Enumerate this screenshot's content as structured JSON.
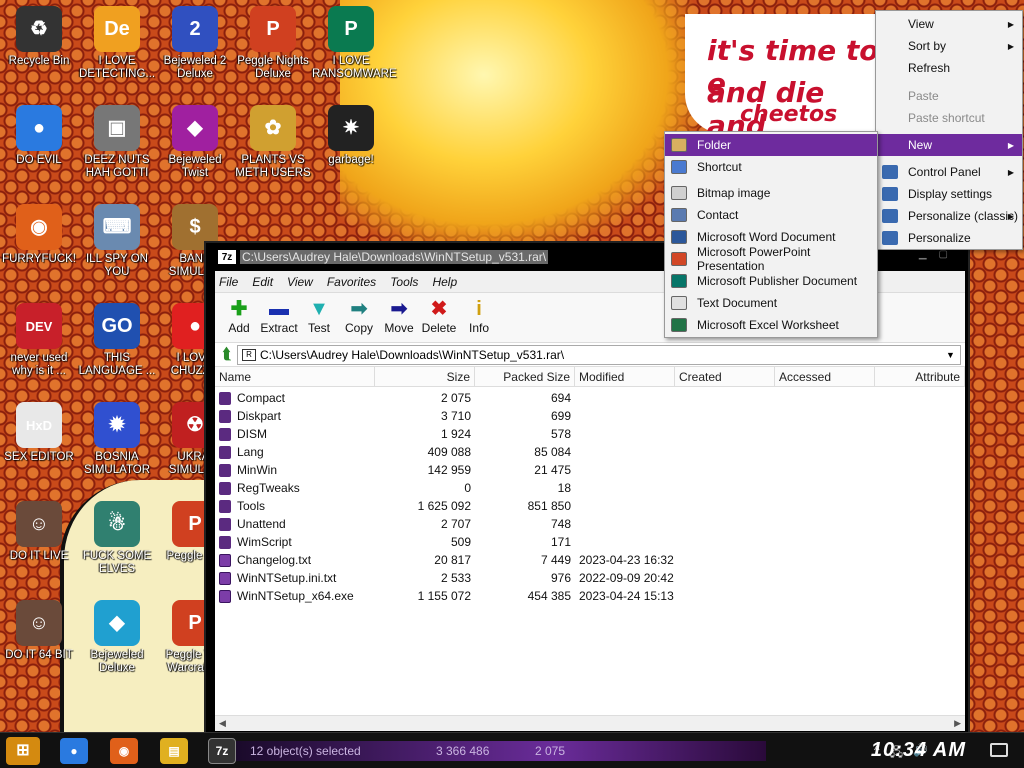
{
  "banner": {
    "line1": "it's time to e",
    "line2": "and die and",
    "line3": "cheetos anc"
  },
  "desktop_icons": [
    {
      "label": "Recycle Bin",
      "icon": "recycle-bin-icon",
      "color": "#333333",
      "glyph": "♻"
    },
    {
      "label": "I LOVE DETECTING...",
      "icon": "detect-it-easy-icon",
      "color": "#f0a020",
      "glyph": "De"
    },
    {
      "label": "Bejeweled 2 Deluxe",
      "icon": "bejeweled2-icon",
      "color": "#3050c0",
      "glyph": "2"
    },
    {
      "label": "Peggle Nights Deluxe",
      "icon": "peggle-nights-icon",
      "color": "#d04020",
      "glyph": "P"
    },
    {
      "label": "I LOVE RANSOMWARE",
      "icon": "publisher-icon",
      "color": "#0a7a50",
      "glyph": "P"
    },
    {
      "label": "DO EVIL",
      "icon": "chrome-icon",
      "color": "#2a7ae0",
      "glyph": "●"
    },
    {
      "label": "DEEZ NUTS HAH GOTTI",
      "icon": "windows-stack-icon",
      "color": "#777777",
      "glyph": "▣"
    },
    {
      "label": "Bejeweled Twist",
      "icon": "bejeweled-twist-icon",
      "color": "#a020a0",
      "glyph": "◆"
    },
    {
      "label": "PLANTS VS METH USERS",
      "icon": "plants-vs-zombies-icon",
      "color": "#d0a030",
      "glyph": "✿"
    },
    {
      "label": "garbage!",
      "icon": "garbage-icon",
      "color": "#222222",
      "glyph": "✷"
    },
    {
      "label": "FURRYFUCK!",
      "icon": "firefox-icon",
      "color": "#e0601a",
      "glyph": "◉"
    },
    {
      "label": "ILL SPY ON YOU",
      "icon": "network-pc-icon",
      "color": "#6a8ab0",
      "glyph": "⌨"
    },
    {
      "label": "BANK SIMULA...",
      "icon": "money-bag-icon",
      "color": "#a07030",
      "glyph": "$"
    },
    {
      "label": "never used why is it ...",
      "icon": "dev-cpp-icon",
      "color": "#c8202a",
      "glyph": "DEV"
    },
    {
      "label": "THIS LANGUAGE ...",
      "icon": "goland-icon",
      "color": "#2050b0",
      "glyph": "GO"
    },
    {
      "label": "I LOVE CHUZZ...",
      "icon": "chuzzle-icon",
      "color": "#e02020",
      "glyph": "●"
    },
    {
      "label": "SEX EDITOR",
      "icon": "hxd-icon",
      "color": "#e8e8e8",
      "glyph": "HxD"
    },
    {
      "label": "BOSNIA SIMULATOR",
      "icon": "mine-icon",
      "color": "#3050d0",
      "glyph": "✹"
    },
    {
      "label": "UKRAI SIMULA...",
      "icon": "radiation-icon",
      "color": "#c02020",
      "glyph": "☢"
    },
    {
      "label": "DO IT LIVE",
      "icon": "portrait-icon",
      "color": "#6a4a3a",
      "glyph": "☺"
    },
    {
      "label": "FUCK SOME ELVES",
      "icon": "santa-icon",
      "color": "#308070",
      "glyph": "☃"
    },
    {
      "label": "Peggle D...",
      "icon": "peggle-icon",
      "color": "#d04020",
      "glyph": "P"
    },
    {
      "label": "DO IT 64 BIT",
      "icon": "portrait-64-icon",
      "color": "#6a4a3a",
      "glyph": "☺"
    },
    {
      "label": "Bejeweled Deluxe",
      "icon": "diamond-icon",
      "color": "#20a0d0",
      "glyph": "◆"
    },
    {
      "label": "Peggle W... Warcraft ...",
      "icon": "peggle-wow-icon",
      "color": "#d04020",
      "glyph": "P"
    }
  ],
  "window": {
    "title": "C:\\Users\\Audrey Hale\\Downloads\\WinNTSetup_v531.rar\\",
    "app_icon_text": "7z",
    "menu": [
      "File",
      "Edit",
      "View",
      "Favorites",
      "Tools",
      "Help"
    ],
    "toolbar": [
      {
        "label": "Add",
        "glyph": "✚",
        "color": "#1aa01a",
        "icon": "add-icon"
      },
      {
        "label": "Extract",
        "glyph": "▬",
        "color": "#1a30b0",
        "icon": "extract-icon"
      },
      {
        "label": "Test",
        "glyph": "▼",
        "color": "#20b0b0",
        "icon": "test-icon"
      },
      {
        "label": "Copy",
        "glyph": "➡",
        "color": "#208080",
        "icon": "copy-icon"
      },
      {
        "label": "Move",
        "glyph": "➡",
        "color": "#1a1a90",
        "icon": "move-icon"
      },
      {
        "label": "Delete",
        "glyph": "✖",
        "color": "#d01a1a",
        "icon": "delete-icon"
      },
      {
        "label": "Info",
        "glyph": "i",
        "color": "#d0a010",
        "icon": "info-icon"
      }
    ],
    "address": "C:\\Users\\Audrey Hale\\Downloads\\WinNTSetup_v531.rar\\",
    "columns": [
      "Name",
      "Size",
      "Packed Size",
      "Modified",
      "Created",
      "Accessed",
      "Attribute"
    ],
    "rows": [
      {
        "name": "Compact",
        "size": "2 075",
        "packed": "694",
        "modified": "",
        "type": "folder"
      },
      {
        "name": "Diskpart",
        "size": "3 710",
        "packed": "699",
        "modified": "",
        "type": "folder"
      },
      {
        "name": "DISM",
        "size": "1 924",
        "packed": "578",
        "modified": "",
        "type": "folder"
      },
      {
        "name": "Lang",
        "size": "409 088",
        "packed": "85 084",
        "modified": "",
        "type": "folder"
      },
      {
        "name": "MinWin",
        "size": "142 959",
        "packed": "21 475",
        "modified": "",
        "type": "folder"
      },
      {
        "name": "RegTweaks",
        "size": "0",
        "packed": "18",
        "modified": "",
        "type": "folder"
      },
      {
        "name": "Tools",
        "size": "1 625 092",
        "packed": "851 850",
        "modified": "",
        "type": "folder"
      },
      {
        "name": "Unattend",
        "size": "2 707",
        "packed": "748",
        "modified": "",
        "type": "folder"
      },
      {
        "name": "WimScript",
        "size": "509",
        "packed": "171",
        "modified": "",
        "type": "folder"
      },
      {
        "name": "Changelog.txt",
        "size": "20 817",
        "packed": "7 449",
        "modified": "2023-04-23 16:32",
        "type": "file"
      },
      {
        "name": "WinNTSetup.ini.txt",
        "size": "2 533",
        "packed": "976",
        "modified": "2022-09-09 20:42",
        "type": "file"
      },
      {
        "name": "WinNTSetup_x64.exe",
        "size": "1 155 072",
        "packed": "454 385",
        "modified": "2023-04-24 15:13",
        "type": "file"
      }
    ]
  },
  "context_menu": {
    "items": [
      {
        "label": "View",
        "has_submenu": true,
        "disabled": false,
        "icon": ""
      },
      {
        "label": "Sort by",
        "has_submenu": true,
        "disabled": false,
        "icon": ""
      },
      {
        "label": "Refresh",
        "has_submenu": false,
        "disabled": false,
        "icon": ""
      },
      {
        "label": "Paste",
        "has_submenu": false,
        "disabled": true,
        "icon": ""
      },
      {
        "label": "Paste shortcut",
        "has_submenu": false,
        "disabled": true,
        "icon": ""
      },
      {
        "label": "New",
        "has_submenu": true,
        "disabled": false,
        "selected": true,
        "icon": ""
      },
      {
        "label": "Control Panel",
        "has_submenu": true,
        "disabled": false,
        "icon": "control-panel-icon"
      },
      {
        "label": "Display settings",
        "has_submenu": false,
        "disabled": false,
        "icon": "display-icon"
      },
      {
        "label": "Personalize (classic)",
        "has_submenu": true,
        "disabled": false,
        "icon": "personalize-classic-icon"
      },
      {
        "label": "Personalize",
        "has_submenu": false,
        "disabled": false,
        "icon": "personalize-icon"
      }
    ]
  },
  "new_submenu": {
    "items": [
      {
        "label": "Folder",
        "icon": "folder-icon",
        "color": "#d8b060",
        "selected": true
      },
      {
        "label": "Shortcut",
        "icon": "shortcut-icon",
        "color": "#4a7ad0"
      },
      {
        "label": "Bitmap image",
        "icon": "bitmap-icon",
        "color": "#d0d0d0"
      },
      {
        "label": "Contact",
        "icon": "contact-icon",
        "color": "#5a7ab0"
      },
      {
        "label": "Microsoft Word Document",
        "icon": "word-icon",
        "color": "#2b579a"
      },
      {
        "label": "Microsoft PowerPoint Presentation",
        "icon": "powerpoint-icon",
        "color": "#d24726"
      },
      {
        "label": "Microsoft Publisher Document",
        "icon": "publisher-doc-icon",
        "color": "#077568"
      },
      {
        "label": "Text Document",
        "icon": "text-doc-icon",
        "color": "#e0e0e0"
      },
      {
        "label": "Microsoft Excel Worksheet",
        "icon": "excel-icon",
        "color": "#217346"
      }
    ]
  },
  "taskbar": {
    "status_selected": "12 object(s) selected",
    "status_total": "3 366 486",
    "status_sel_size": "2 075",
    "clock": "10:34 AM",
    "active_app_label": "7z"
  }
}
